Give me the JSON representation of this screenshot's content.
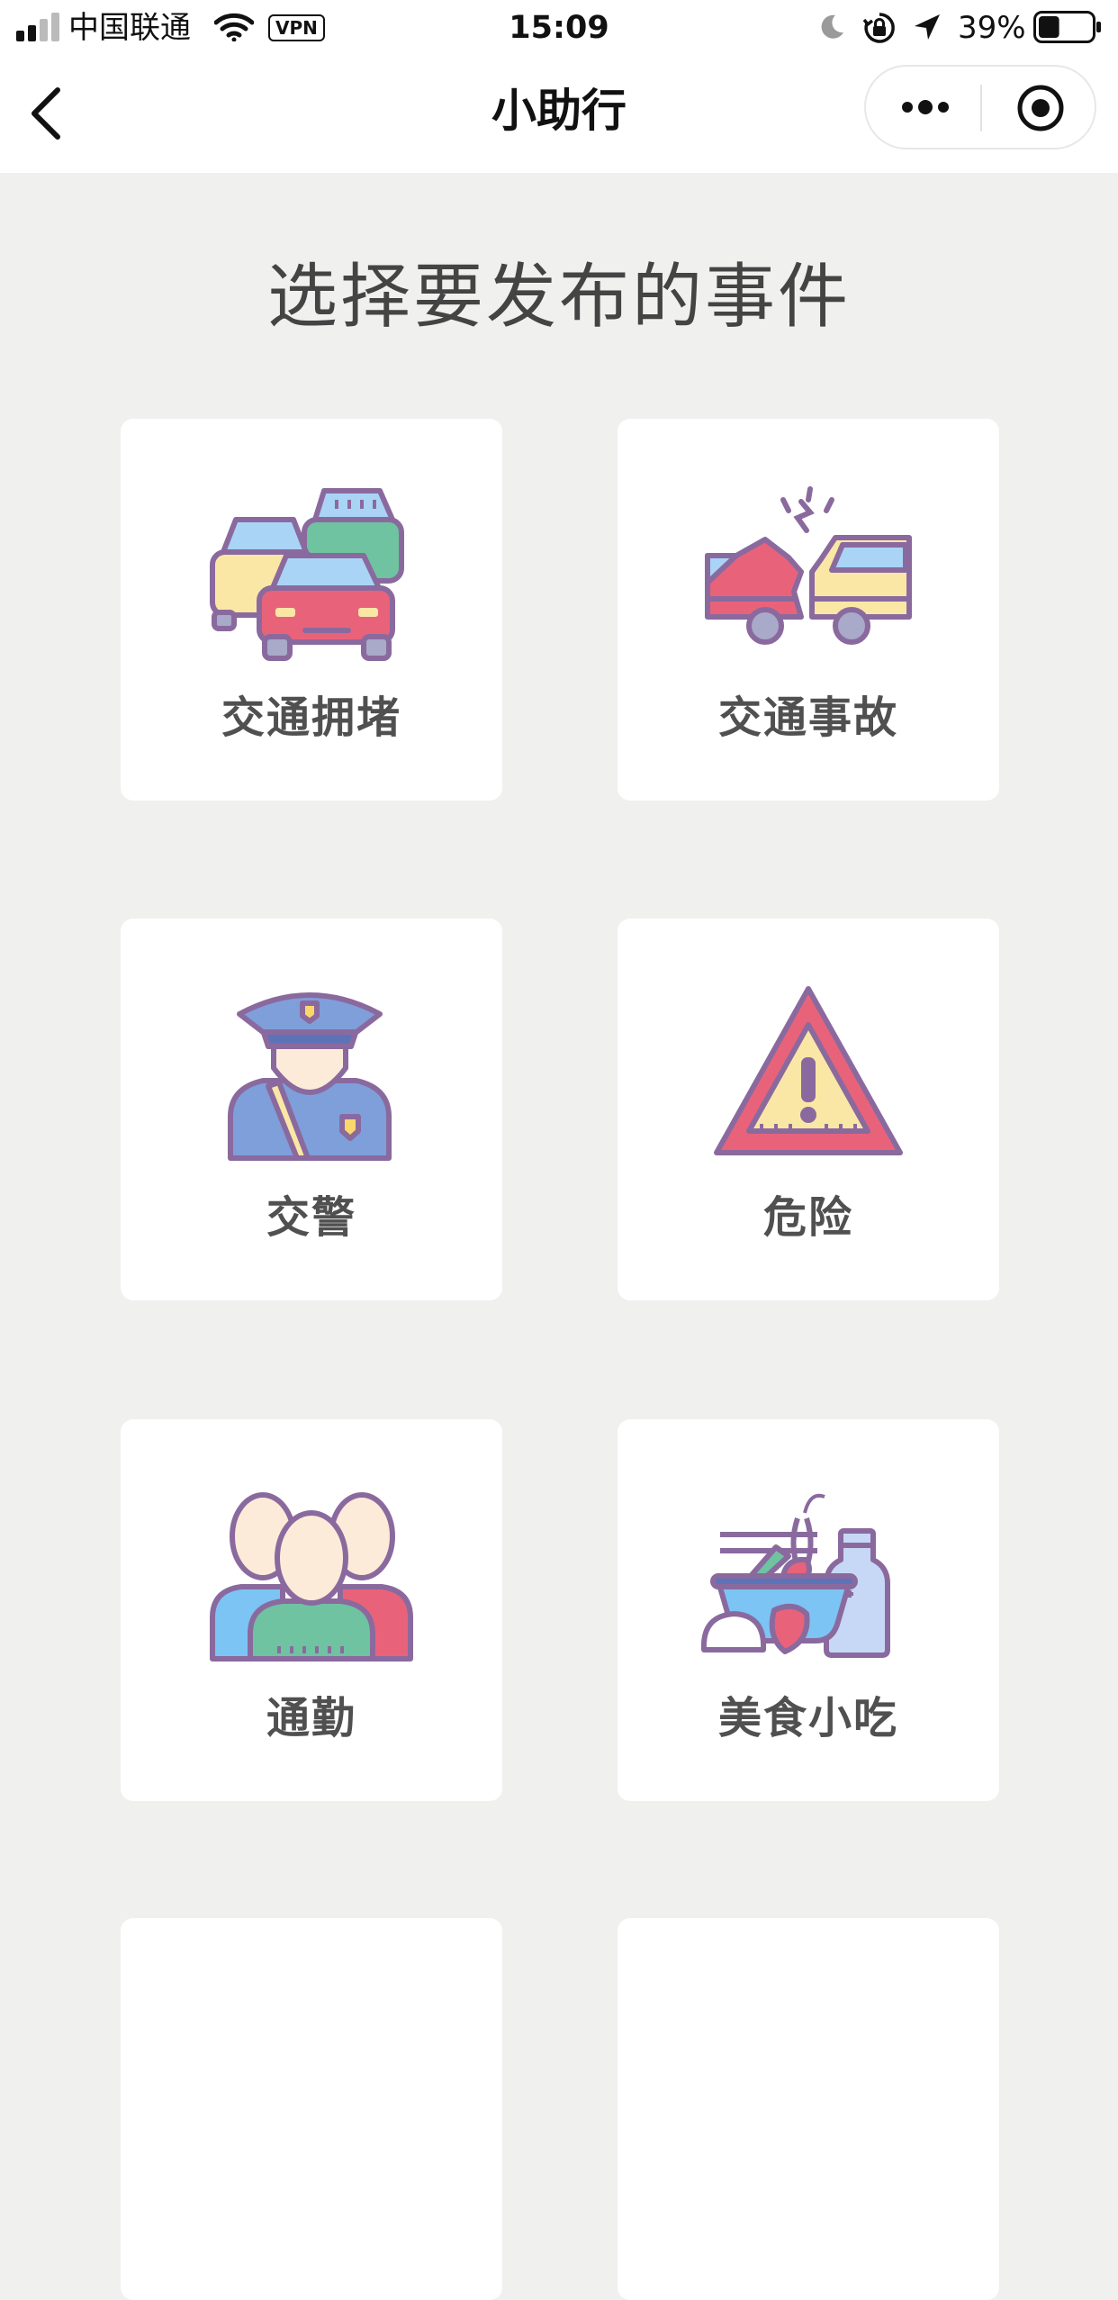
{
  "status_bar": {
    "carrier": "中国联通",
    "vpn": "VPN",
    "time": "15:09",
    "battery_percent": "39%",
    "battery_level": 0.39
  },
  "nav": {
    "title": "小助行"
  },
  "heading": "选择要发布的事件",
  "events": [
    {
      "label": "交通拥堵",
      "icon": "traffic-jam-icon"
    },
    {
      "label": "交通事故",
      "icon": "car-accident-icon"
    },
    {
      "label": "交警",
      "icon": "traffic-police-icon"
    },
    {
      "label": "危险",
      "icon": "warning-triangle-icon"
    },
    {
      "label": "通勤",
      "icon": "commuters-icon"
    },
    {
      "label": "美食小吃",
      "icon": "food-snacks-icon"
    }
  ],
  "colors": {
    "background": "#f0f0ef",
    "card": "#ffffff",
    "icon_outline": "#8a6a9e",
    "icon_red": "#e8637a",
    "icon_blue": "#a9d4f5",
    "icon_yellow": "#fbe7a5",
    "icon_green": "#6fc3a0"
  }
}
